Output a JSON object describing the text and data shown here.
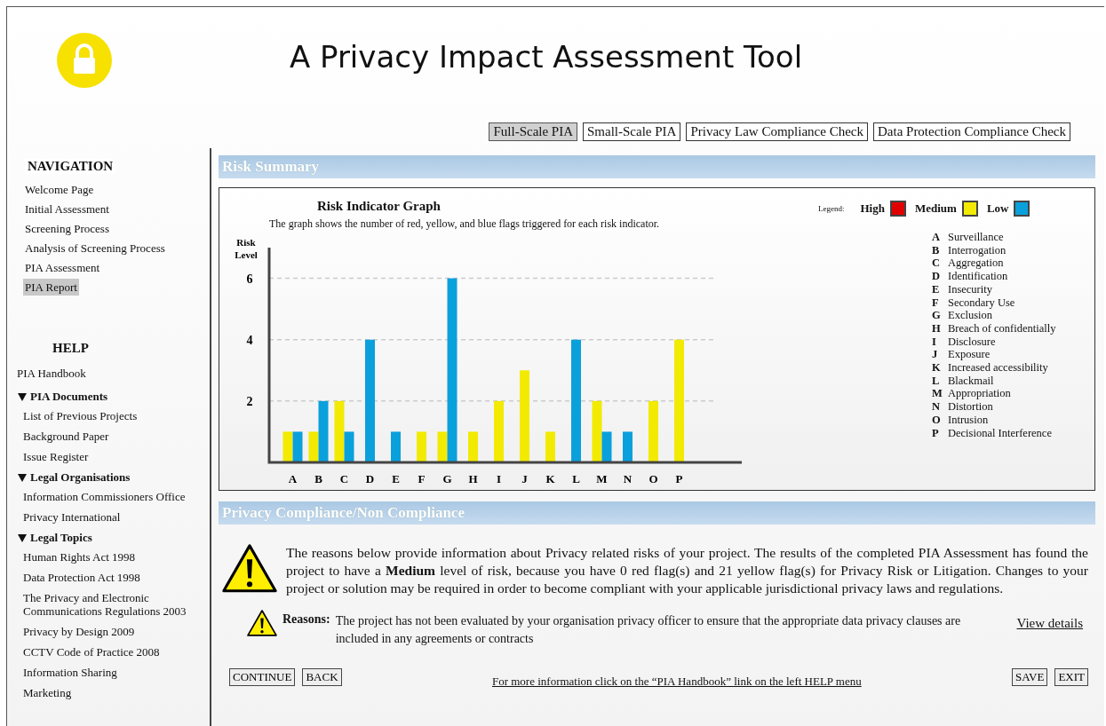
{
  "header": {
    "title": "A Privacy Impact Assessment Tool"
  },
  "tabs": [
    {
      "label": "Full-Scale PIA",
      "selected": true
    },
    {
      "label": "Small-Scale PIA",
      "selected": false
    },
    {
      "label": "Privacy Law Compliance Check",
      "selected": false
    },
    {
      "label": "Data Protection Compliance Check",
      "selected": false
    }
  ],
  "navigation": {
    "heading": "NAVIGATION",
    "items": [
      {
        "label": "Welcome Page",
        "selected": false
      },
      {
        "label": "Initial Assessment",
        "selected": false
      },
      {
        "label": "Screening Process",
        "selected": false
      },
      {
        "label": "Analysis of Screening Process",
        "selected": false
      },
      {
        "label": "PIA Assessment",
        "selected": false
      },
      {
        "label": "PIA Report",
        "selected": true
      }
    ]
  },
  "help": {
    "heading": "HELP",
    "items": [
      {
        "label": "PIA Handbook"
      },
      {
        "label": "PIA Documents",
        "expanded": true,
        "children": [
          {
            "label": "List of Previous Projects"
          },
          {
            "label": "Background Paper"
          },
          {
            "label": "Issue Register"
          }
        ]
      },
      {
        "label": "Legal Organisations",
        "expanded": true,
        "children": [
          {
            "label": "Information Commissioners Office"
          },
          {
            "label": "Privacy International"
          }
        ]
      },
      {
        "label": "Legal Topics",
        "expanded": true,
        "children": [
          {
            "label": "Human Rights Act 1998"
          },
          {
            "label": "Data Protection Act 1998"
          },
          {
            "label": "The Privacy and Electronic Communications Regulations 2003"
          },
          {
            "label": "Privacy by Design 2009"
          },
          {
            "label": "CCTV Code of Practice 2008"
          },
          {
            "label": "Information Sharing"
          },
          {
            "label": "Marketing"
          }
        ]
      }
    ]
  },
  "risk_summary": {
    "heading": "Risk Summary",
    "legend_label": "Legend:",
    "chart_data": {
      "type": "bar",
      "title": "Risk Indicator Graph",
      "subtitle": "The graph shows the number of red, yellow, and blue flags triggered for each risk indicator.",
      "ylabel": "Risk Level",
      "grid": true,
      "categories": [
        "A",
        "B",
        "C",
        "D",
        "E",
        "F",
        "G",
        "H",
        "I",
        "J",
        "K",
        "L",
        "M",
        "N",
        "O",
        "P"
      ],
      "series": [
        {
          "name": "High",
          "color": "#e00000",
          "values": [
            0,
            0,
            0,
            0,
            0,
            0,
            0,
            0,
            0,
            0,
            0,
            0,
            0,
            0,
            0,
            0
          ]
        },
        {
          "name": "Medium",
          "color": "#f2ea00",
          "values": [
            1,
            1,
            2,
            0,
            0,
            1,
            1,
            1,
            2,
            3,
            1,
            0,
            2,
            0,
            2,
            4
          ]
        },
        {
          "name": "Low",
          "color": "#0aa0dc",
          "values": [
            1,
            2,
            1,
            4,
            1,
            0,
            6,
            0,
            0,
            0,
            0,
            4,
            1,
            1,
            0,
            0
          ]
        }
      ],
      "ylim": [
        0,
        7
      ],
      "yticks": [
        2,
        4,
        6
      ]
    },
    "key": [
      {
        "letter": "A",
        "name": "Surveillance"
      },
      {
        "letter": "B",
        "name": "Interrogation"
      },
      {
        "letter": "C",
        "name": "Aggregation"
      },
      {
        "letter": "D",
        "name": "Identification"
      },
      {
        "letter": "E",
        "name": "Insecurity"
      },
      {
        "letter": "F",
        "name": "Secondary Use"
      },
      {
        "letter": "G",
        "name": "Exclusion"
      },
      {
        "letter": "H",
        "name": "Breach of confidentially"
      },
      {
        "letter": "I",
        "name": "Disclosure"
      },
      {
        "letter": "J",
        "name": "Exposure"
      },
      {
        "letter": "K",
        "name": "Increased accessibility"
      },
      {
        "letter": "L",
        "name": "Blackmail"
      },
      {
        "letter": "M",
        "name": "Appropriation"
      },
      {
        "letter": "N",
        "name": "Distortion"
      },
      {
        "letter": "O",
        "name": "Intrusion"
      },
      {
        "letter": "P",
        "name": "Decisional Interference"
      }
    ]
  },
  "compliance": {
    "heading": "Privacy Compliance/Non Compliance",
    "message": "The reasons below provide information about Privacy related risks of your project. The results of the completed PIA Assessment has found the project to have a **Medium** level of risk, because you have 0 red flag(s) and 21 yellow flag(s) for Privacy Risk or Litigation. Changes to your project or solution may be required in order to become compliant with your applicable jurisdictional privacy laws and regulations.",
    "reasons_label": "Reasons:",
    "reason": "The project has not been evaluated by your organisation privacy officer to ensure that the appropriate data privacy clauses are included in any agreements or contracts",
    "details_link": "View details"
  },
  "footer": {
    "left_buttons": [
      "CONTINUE",
      "BACK"
    ],
    "info": "For more information click on the “PIA Handbook” link on the left HELP menu",
    "right_buttons": [
      "SAVE",
      "EXIT"
    ]
  }
}
